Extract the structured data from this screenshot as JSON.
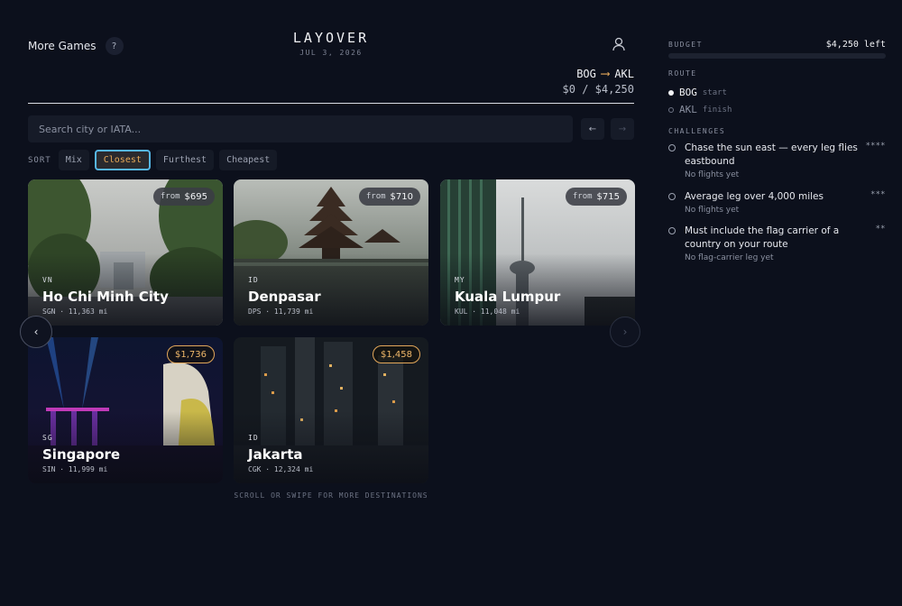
{
  "header": {
    "more_games": "More Games",
    "help": "?",
    "title": "LAYOVER",
    "date": "JUL 3, 2026",
    "route_from": "BOG",
    "route_arrow": "⟶",
    "route_to": "AKL",
    "spent": "$0 / $4,250"
  },
  "search": {
    "placeholder": "Search city or IATA...",
    "prev": "←",
    "next": "→"
  },
  "sort": {
    "label": "SORT",
    "options": [
      "Mix",
      "Closest",
      "Furthest",
      "Cheapest"
    ],
    "active": "Closest"
  },
  "cards": [
    {
      "price_prefix": "from",
      "price": "$695",
      "country": "VN",
      "city": "Ho Chi Minh City",
      "iata": "SGN",
      "distance": "11,363 mi"
    },
    {
      "price_prefix": "from",
      "price": "$710",
      "country": "ID",
      "city": "Denpasar",
      "iata": "DPS",
      "distance": "11,739 mi"
    },
    {
      "price_prefix": "from",
      "price": "$715",
      "country": "MY",
      "city": "Kuala Lumpur",
      "iata": "KUL",
      "distance": "11,048 mi"
    },
    {
      "price_prefix": "",
      "price": "$1,736",
      "country": "SG",
      "city": "Singapore",
      "iata": "SIN",
      "distance": "11,999 mi"
    },
    {
      "price_prefix": "",
      "price": "$1,458",
      "country": "ID",
      "city": "Jakarta",
      "iata": "CGK",
      "distance": "12,324 mi"
    }
  ],
  "carousel": {
    "left": "‹",
    "right": "›"
  },
  "hint": "SCROLL OR SWIPE FOR MORE DESTINATIONS",
  "panel": {
    "budget_label": "BUDGET",
    "budget_value": "$4,250 left",
    "route_label": "ROUTE",
    "stops": [
      {
        "code": "BOG",
        "tag": "start"
      },
      {
        "code": "AKL",
        "tag": "finish"
      }
    ],
    "challenges_label": "CHALLENGES",
    "challenges": [
      {
        "text": "Chase the sun east — every leg flies eastbound",
        "status": "No flights yet",
        "stars": "****"
      },
      {
        "text": "Average leg over 4,000 miles",
        "status": "No flights yet",
        "stars": "***"
      },
      {
        "text": "Must include the flag carrier of a country on your route",
        "status": "No flag-carrier leg yet",
        "stars": "**"
      }
    ]
  }
}
